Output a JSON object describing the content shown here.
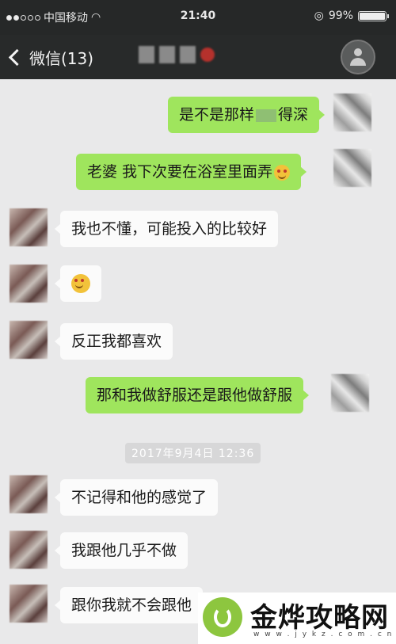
{
  "status_bar": {
    "carrier": "中国移动",
    "time": "21:40",
    "battery": "99%",
    "battery_level": 0.99
  },
  "nav": {
    "back_label": "微信(13)"
  },
  "messages": [
    {
      "side": "right",
      "text_before": "是不是那样",
      "text_after": "得深"
    },
    {
      "side": "right",
      "text": "老婆 我下次要在浴室里面弄",
      "emoji": "heart-eyes-emoji"
    },
    {
      "side": "left",
      "text": "我也不懂，可能投入的比较好"
    },
    {
      "side": "left",
      "emoji": "heart-eyes-emoji"
    },
    {
      "side": "left",
      "text": "反正我都喜欢"
    },
    {
      "side": "right",
      "text": "那和我做舒服还是跟他做舒服"
    },
    {
      "side": "left",
      "text": "不记得和他的感觉了"
    },
    {
      "side": "left",
      "text": "我跟他几乎不做"
    },
    {
      "side": "left",
      "text": "跟你我就不会跟他"
    }
  ],
  "timestamp": "2017年9月4日 12:36",
  "watermark": {
    "title": "金烨攻略网",
    "url": "w w w . j y k z . c o m . c n"
  },
  "colors": {
    "sent_bubble": "#9fe55d",
    "received_bubble": "#fbfbfb",
    "chat_background": "#e9e9ea",
    "header": "#282a2a"
  }
}
